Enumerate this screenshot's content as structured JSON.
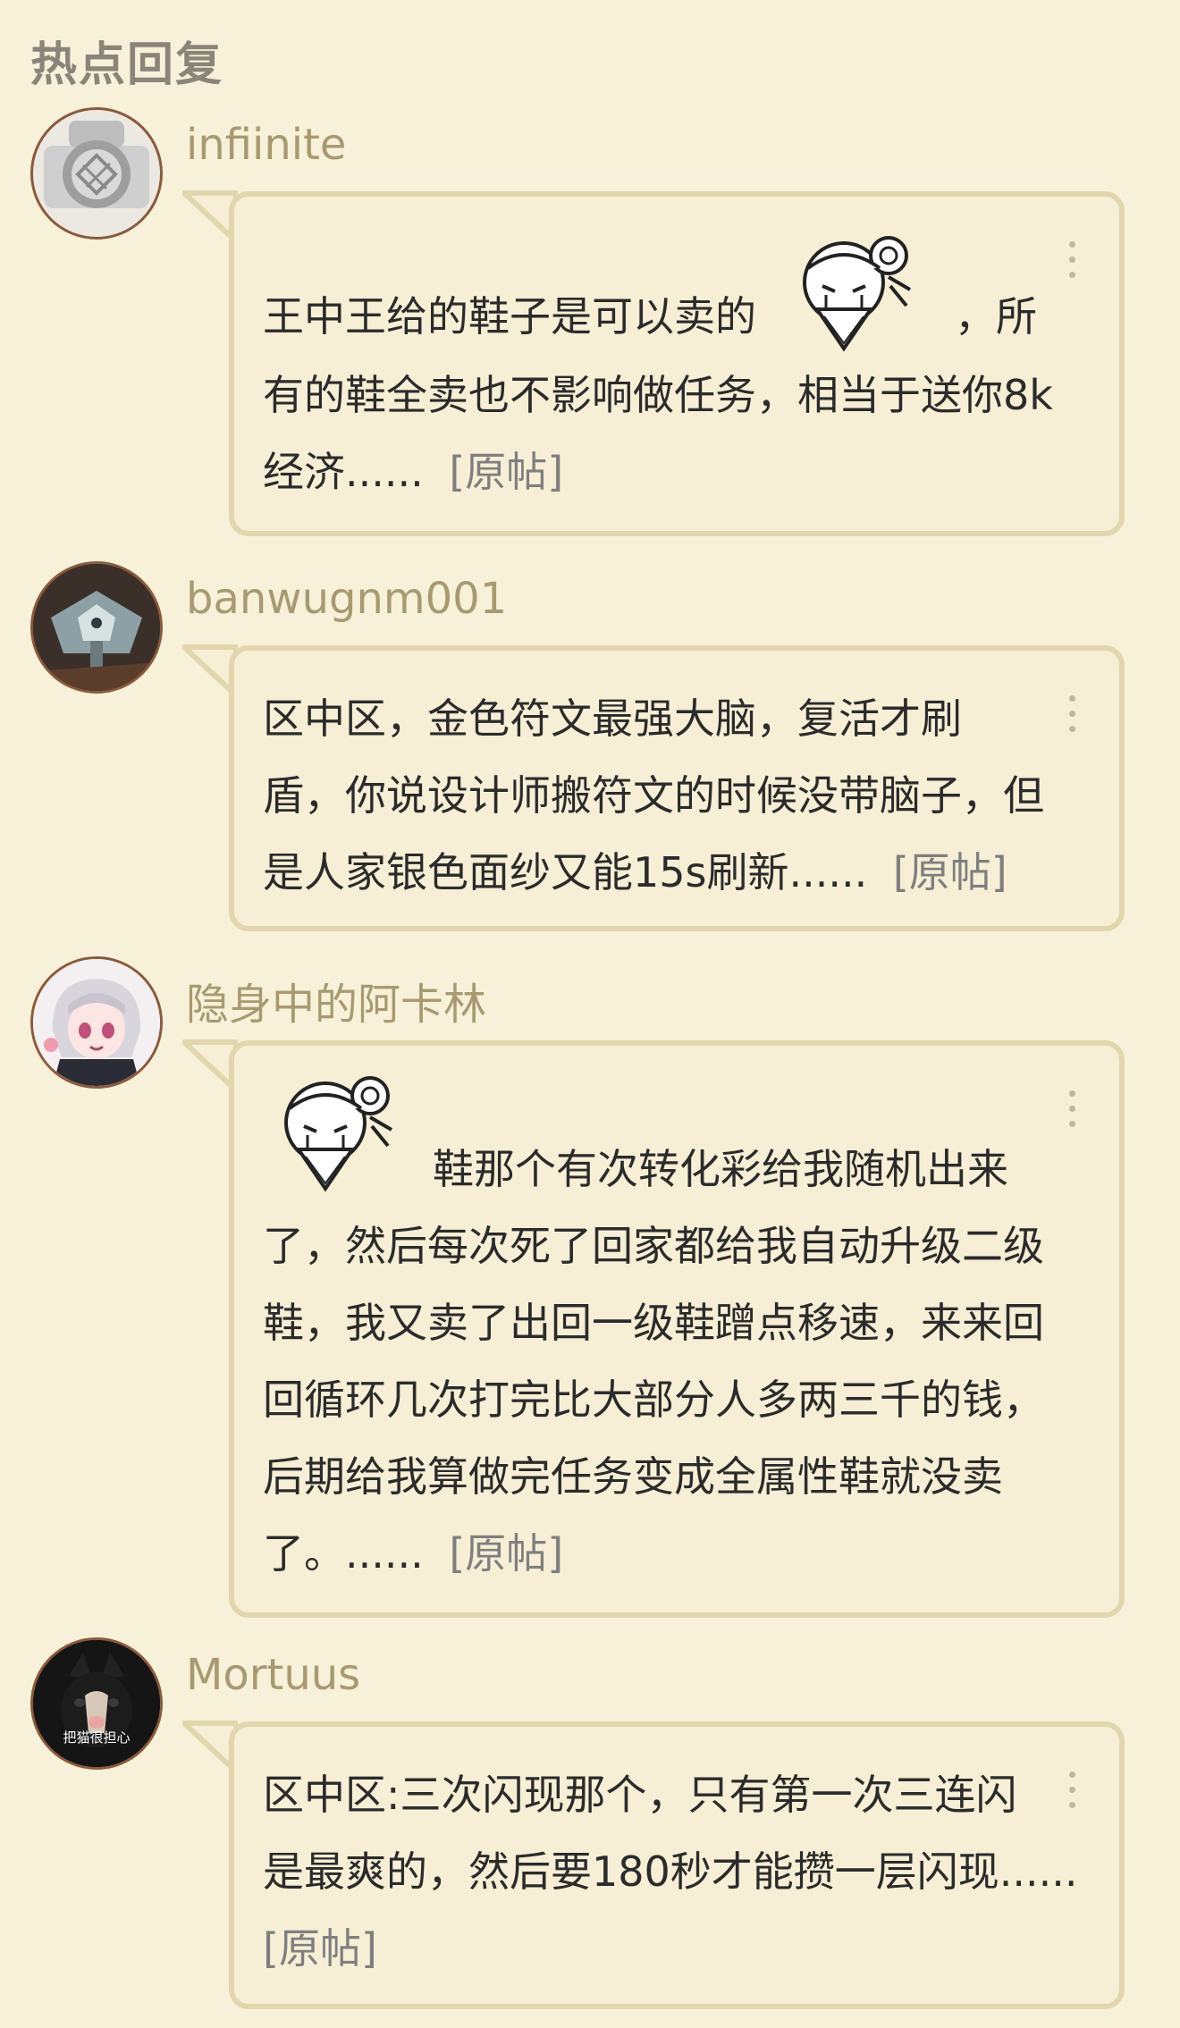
{
  "section": {
    "title": "热点回复"
  },
  "replies": [
    {
      "username": "infiinite",
      "avatar_icon": "diving-helmet-avatar",
      "lines": [
        "王中王给的鞋子是可以卖的",
        "，所",
        "有的鞋全卖也不影响做任务，相当于送你8k",
        "经济......"
      ],
      "original_link": "[原帖]",
      "sticker": "crying-girl-sticker"
    },
    {
      "username": "banwugnm001",
      "avatar_icon": "mech-avatar",
      "lines": [
        "区中区，金色符文最强大脑，复活才刷",
        "盾，你说设计师搬符文的时候没带脑子，但",
        "是人家银色面纱又能15s刷新......"
      ],
      "original_link": "[原帖]"
    },
    {
      "username": "隐身中的阿卡林",
      "avatar_icon": "anime-girl-avatar",
      "lines": [
        "鞋那个有次转化彩给我随机出来",
        "了，然后每次死了回家都给我自动升级二级",
        "鞋，我又卖了出回一级鞋蹭点移速，来来回",
        "回循环几次打完比大部分人多两三千的钱，",
        "后期给我算做完任务变成全属性鞋就没卖",
        "了。......"
      ],
      "original_link": "[原帖]",
      "sticker": "crying-girl-sticker"
    },
    {
      "username": "Mortuus",
      "avatar_icon": "cat-avatar",
      "avatar_caption": "把猫很担心",
      "lines": [
        "区中区:三次闪现那个，只有第一次三连闪",
        "是最爽的，然后要180秒才能攒一层闪现......"
      ],
      "original_link": "[原帖]"
    }
  ],
  "colors": {
    "background": "#f7f1d9",
    "bubble_border": "#e2d6ad",
    "username": "#a89a70",
    "link": "#7f7f7f"
  }
}
